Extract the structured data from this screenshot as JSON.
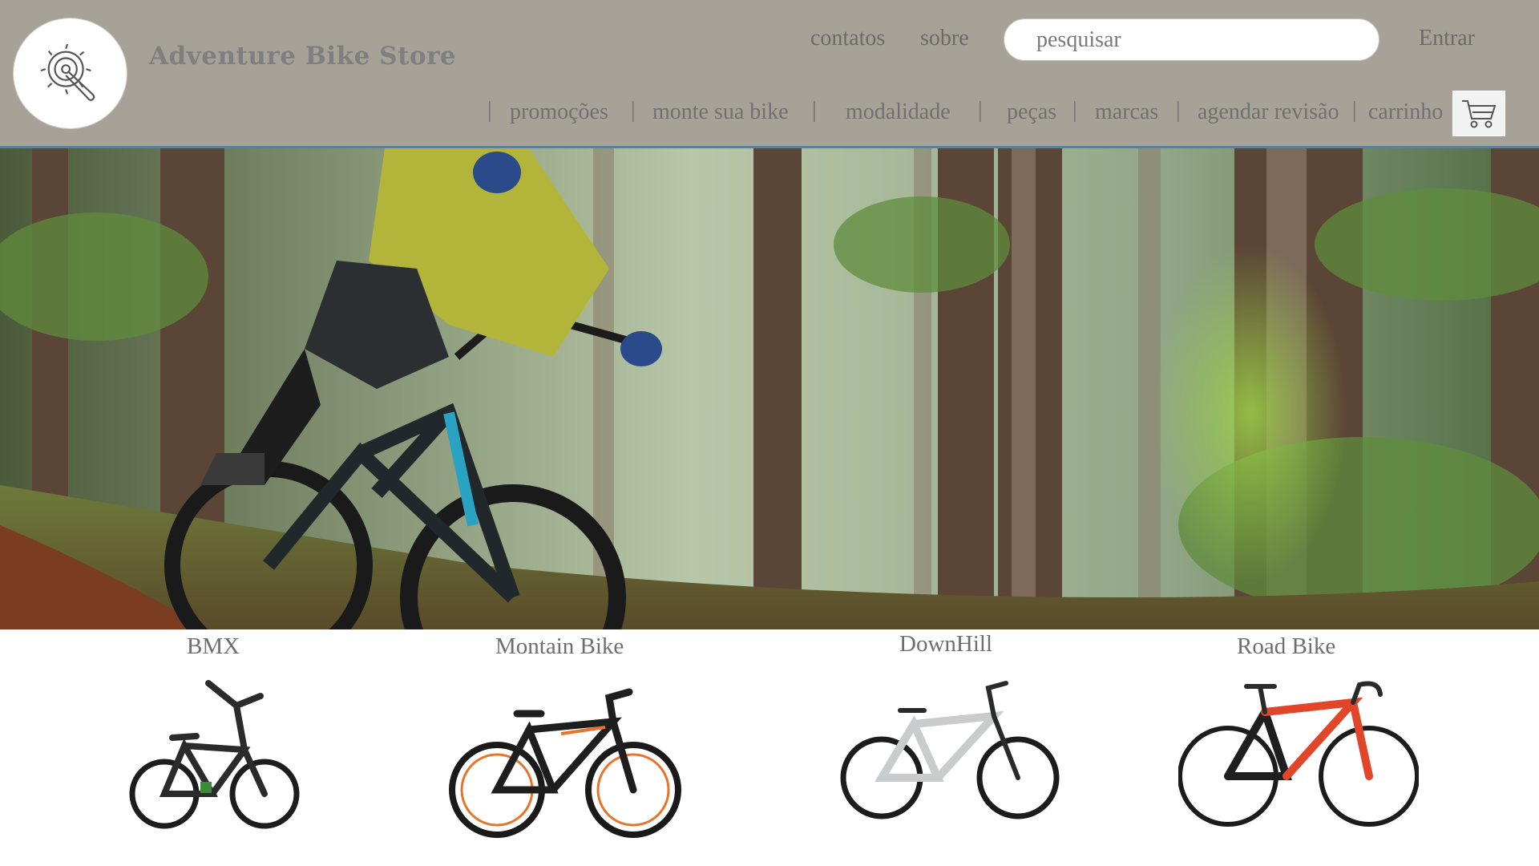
{
  "header": {
    "brand": "Adventure Bike Store",
    "top_links": {
      "contatos": "contatos",
      "sobre": "sobre",
      "entrar": "Entrar"
    },
    "search": {
      "placeholder": "pesquisar"
    },
    "nav": [
      "promoções",
      "monte sua bike",
      "modalidade",
      "peças",
      "marcas",
      "agendar revisão",
      "carrinho"
    ],
    "logo_icon": "bike-crank-icon",
    "cart_icon": "shopping-cart-icon"
  },
  "hero": {
    "image": "mountain-biker-forest-photo"
  },
  "categories": [
    {
      "label": "BMX",
      "icon": "bmx-bike-image",
      "frame_color": "#1d1d1d"
    },
    {
      "label": "Montain Bike",
      "icon": "mountain-bike-image",
      "frame_color": "#1b1b1b"
    },
    {
      "label": "DownHill",
      "icon": "downhill-bike-image",
      "frame_color": "#c9cbcd"
    },
    {
      "label": "Road Bike",
      "icon": "road-bike-image",
      "frame_color": "#e2462a"
    }
  ],
  "colors": {
    "header_bg": "#a7a298",
    "accent_rule": "#5f7f95"
  }
}
